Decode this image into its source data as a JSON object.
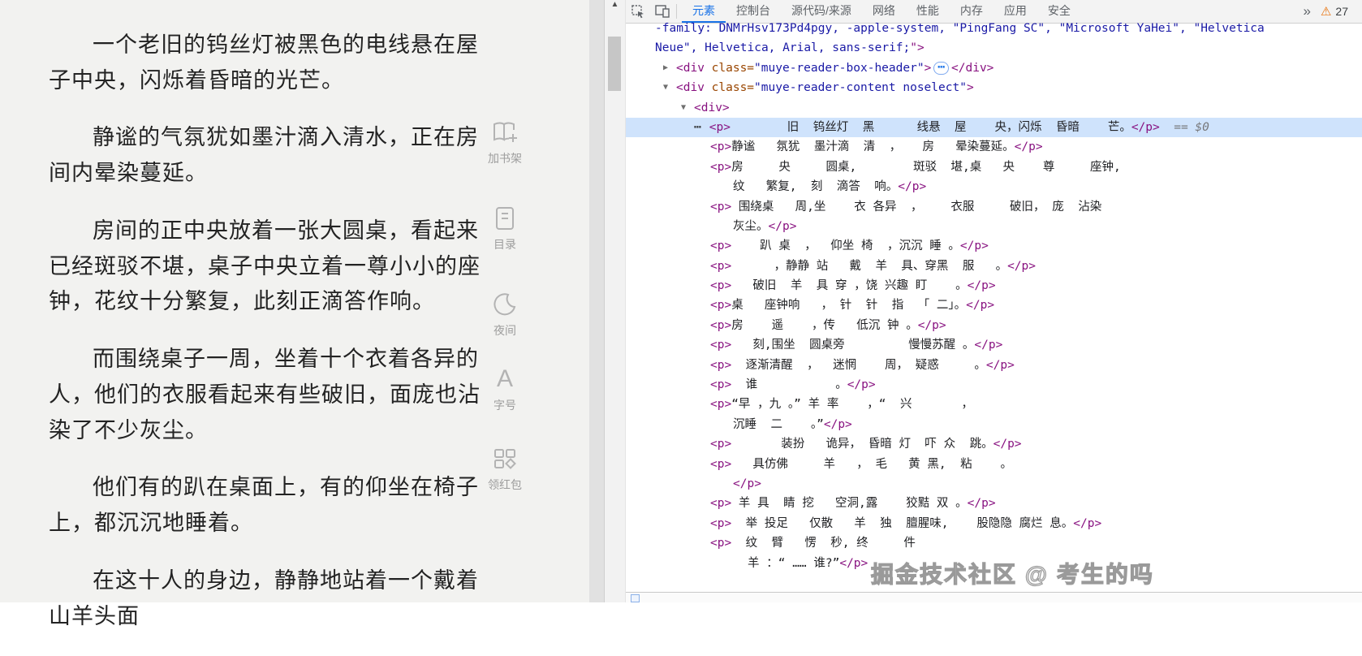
{
  "reader": {
    "paragraphs": [
      "一个老旧的钨丝灯被黑色的电线悬在屋子中央，闪烁着昏暗的光芒。",
      "静谧的气氛犹如墨汁滴入清水，正在房间内晕染蔓延。",
      "房间的正中央放着一张大圆桌，看起来已经斑驳不堪，桌子中央立着一尊小小的座钟，花纹十分繁复，此刻正滴答作响。",
      "而围绕桌子一周，坐着十个衣着各异的人，他们的衣服看起来有些破旧，面庞也沾染了不少灰尘。",
      "他们有的趴在桌面上，有的仰坐在椅子上，都沉沉地睡着。",
      "在这十人的身边，静静地站着一个戴着山羊头面"
    ],
    "toolbar": [
      {
        "label": "加书架"
      },
      {
        "label": "目录"
      },
      {
        "label": "夜间"
      },
      {
        "label": "字号",
        "glyph": "A"
      },
      {
        "label": "领红包"
      }
    ]
  },
  "devtools": {
    "tabs": [
      "元素",
      "控制台",
      "源代码/来源",
      "网络",
      "性能",
      "内存",
      "应用",
      "安全"
    ],
    "active_tab": "元素",
    "more_label": "»",
    "warning_icon": "⚠",
    "warning_count": "27",
    "scroll_up_glyph": "▲",
    "lines": [
      {
        "ind": 1,
        "seg": [
          [
            "val",
            "-family: DNMrHsv173Pd4pgy, -apple-system, \"PingFang SC\", \"Microsoft YaHei\", \"Helvetica"
          ]
        ]
      },
      {
        "ind": 1,
        "seg": [
          [
            "val",
            "Neue\", Helvetica, Arial, sans-serif;"
          ],
          [
            "tag",
            "\">"
          ]
        ]
      },
      {
        "ind": 2,
        "arrow": "closed",
        "seg": [
          [
            "tag",
            "<div "
          ],
          [
            "attr",
            "class="
          ],
          [
            "val",
            "\"muye-reader-box-header\""
          ],
          [
            "tag",
            ">"
          ],
          [
            "pill",
            "⋯"
          ],
          [
            "tag",
            "</div>"
          ]
        ]
      },
      {
        "ind": 2,
        "arrow": "open",
        "seg": [
          [
            "tag",
            "<div "
          ],
          [
            "attr",
            "class="
          ],
          [
            "val",
            "\"muye-reader-content noselect\""
          ],
          [
            "tag",
            ">"
          ]
        ]
      },
      {
        "ind": 3,
        "arrow": "open",
        "seg": [
          [
            "tag",
            "<div>"
          ]
        ]
      },
      {
        "ind": 4,
        "sel": true,
        "dots": true,
        "seg": [
          [
            "tag",
            "<p>"
          ],
          [
            "text",
            "        旧  钨丝灯  黑      线悬  屋    央，闪烁  昏暗    芒。"
          ],
          [
            "tag",
            "</p>"
          ],
          [
            "badge",
            "  == $0"
          ]
        ]
      },
      {
        "ind": 4,
        "seg": [
          [
            "tag",
            "<p>"
          ],
          [
            "text",
            "静谧   氛犹  墨汁滴  清  ，   房   晕染蔓延。"
          ],
          [
            "tag",
            "</p>"
          ]
        ]
      },
      {
        "ind": 4,
        "seg": [
          [
            "tag",
            "<p>"
          ],
          [
            "text",
            "房     央     圆桌,        斑驳  堪,桌   央    尊     座钟,"
          ]
        ]
      },
      {
        "ind": 5,
        "seg": [
          [
            "text",
            "纹   繁复,  刻  滴答  响。"
          ],
          [
            "tag",
            "</p>"
          ]
        ]
      },
      {
        "ind": 4,
        "seg": [
          [
            "tag",
            "<p>"
          ],
          [
            "text",
            " 围绕桌   周,坐    衣 各异  ，    衣服     破旧， 庞  沾染"
          ]
        ]
      },
      {
        "ind": 5,
        "seg": [
          [
            "text",
            "灰尘。"
          ],
          [
            "tag",
            "</p>"
          ]
        ]
      },
      {
        "ind": 4,
        "seg": [
          [
            "tag",
            "<p>"
          ],
          [
            "text",
            "    趴 桌  ，  仰坐 椅  ，沉沉 睡 。"
          ],
          [
            "tag",
            "</p>"
          ]
        ]
      },
      {
        "ind": 4,
        "seg": [
          [
            "tag",
            "<p>"
          ],
          [
            "text",
            "      ，静静 站   戴  羊  具、穿黑  服   。"
          ],
          [
            "tag",
            "</p>"
          ]
        ]
      },
      {
        "ind": 4,
        "seg": [
          [
            "tag",
            "<p>"
          ],
          [
            "text",
            "   破旧  羊  具 穿 ，饶 兴趣 盯    。"
          ],
          [
            "tag",
            "</p>"
          ]
        ]
      },
      {
        "ind": 4,
        "seg": [
          [
            "tag",
            "<p>"
          ],
          [
            "text",
            "桌   座钟响   ， 针  针  指  「 二」。"
          ],
          [
            "tag",
            "</p>"
          ]
        ]
      },
      {
        "ind": 4,
        "seg": [
          [
            "tag",
            "<p>"
          ],
          [
            "text",
            "房    遥    ，传   低沉 钟 。"
          ],
          [
            "tag",
            "</p>"
          ]
        ]
      },
      {
        "ind": 4,
        "seg": [
          [
            "tag",
            "<p>"
          ],
          [
            "text",
            "   刻,围坐  圆桌旁         慢慢苏醒 。"
          ],
          [
            "tag",
            "</p>"
          ]
        ]
      },
      {
        "ind": 4,
        "seg": [
          [
            "tag",
            "<p>"
          ],
          [
            "text",
            "  逐渐清醒  ，  迷惘    周， 疑惑     。"
          ],
          [
            "tag",
            "</p>"
          ]
        ]
      },
      {
        "ind": 4,
        "seg": [
          [
            "tag",
            "<p>"
          ],
          [
            "text",
            "  谁           。"
          ],
          [
            "tag",
            "</p>"
          ]
        ]
      },
      {
        "ind": 4,
        "seg": [
          [
            "tag",
            "<p>"
          ],
          [
            "text",
            "“早 ，九 。” 羊 率    ，“  兴       ，"
          ]
        ]
      },
      {
        "ind": 5,
        "seg": [
          [
            "text",
            "沉睡  二    。”"
          ],
          [
            "tag",
            "</p>"
          ]
        ]
      },
      {
        "ind": 4,
        "seg": [
          [
            "tag",
            "<p>"
          ],
          [
            "text",
            "       装扮   诡异， 昏暗 灯  吓 众  跳。"
          ],
          [
            "tag",
            "</p>"
          ]
        ]
      },
      {
        "ind": 4,
        "seg": [
          [
            "tag",
            "<p>"
          ],
          [
            "text",
            "   具仿佛     羊   ， 毛   黄 黑,  粘    。"
          ]
        ]
      },
      {
        "ind": 5,
        "seg": [
          [
            "tag",
            "</p>"
          ]
        ]
      },
      {
        "ind": 4,
        "seg": [
          [
            "tag",
            "<p>"
          ],
          [
            "text",
            " 羊 具  睛 挖   空洞,露    狡黠 双 。"
          ],
          [
            "tag",
            "</p>"
          ]
        ]
      },
      {
        "ind": 4,
        "seg": [
          [
            "tag",
            "<p>"
          ],
          [
            "text",
            "  举 投足   仅散   羊  独  膻腥味,    股隐隐 腐烂 息。"
          ],
          [
            "tag",
            "</p>"
          ]
        ]
      },
      {
        "ind": 4,
        "seg": [
          [
            "tag",
            "<p>"
          ],
          [
            "text",
            "  纹  臂   愣  秒, 终     件"
          ]
        ]
      },
      {
        "ind": 6,
        "seg": [
          [
            "text",
            "羊 ：“ …… 谁?”"
          ],
          [
            "tag",
            "</p>"
          ]
        ]
      }
    ]
  },
  "watermark": "掘金技术社区 @ 考生的吗",
  "colors": {
    "reader_bg": "#f2f2f0",
    "selection_bg": "#cfe3fc",
    "tab_active": "#1a73e8",
    "tag": "#881280",
    "attr_value": "#1a1aa6",
    "warning": "#e8710a"
  }
}
